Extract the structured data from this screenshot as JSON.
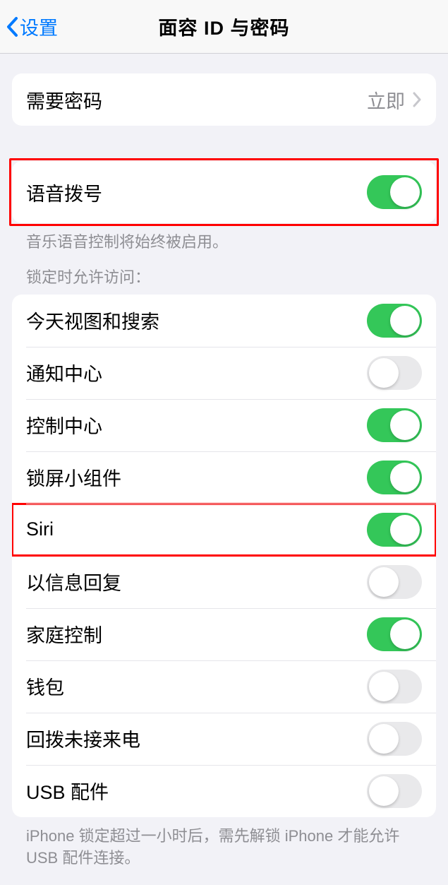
{
  "nav": {
    "back_label": "设置",
    "title": "面容 ID 与密码"
  },
  "passcode": {
    "label": "需要密码",
    "value": "立即"
  },
  "voice_dial": {
    "label": "语音拨号",
    "enabled": true,
    "footer": "音乐语音控制将始终被启用。"
  },
  "locked_access": {
    "header": "锁定时允许访问：",
    "items": [
      {
        "label": "今天视图和搜索",
        "enabled": true
      },
      {
        "label": "通知中心",
        "enabled": false
      },
      {
        "label": "控制中心",
        "enabled": true
      },
      {
        "label": "锁屏小组件",
        "enabled": true
      },
      {
        "label": "Siri",
        "enabled": true
      },
      {
        "label": "以信息回复",
        "enabled": false
      },
      {
        "label": "家庭控制",
        "enabled": true
      },
      {
        "label": "钱包",
        "enabled": false
      },
      {
        "label": "回拨未接来电",
        "enabled": false
      },
      {
        "label": "USB 配件",
        "enabled": false
      }
    ],
    "footer": "iPhone 锁定超过一小时后，需先解锁 iPhone 才能允许USB 配件连接。"
  }
}
